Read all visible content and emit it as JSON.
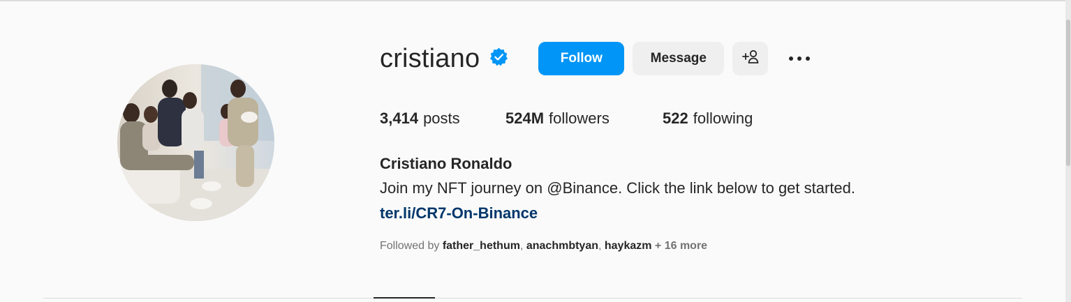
{
  "profile": {
    "username": "cristiano",
    "verified_icon": "verified-badge-icon",
    "full_name": "Cristiano Ronaldo",
    "bio": "Join my NFT journey on @Binance. Click the link below to get started.",
    "link": "ter.li/CR7-On-Binance",
    "avatar_alt": "profile-photo"
  },
  "actions": {
    "follow_label": "Follow",
    "message_label": "Message",
    "add_user_icon": "add-user-icon",
    "more_icon": "more-options-icon"
  },
  "stats": {
    "posts_count": "3,414",
    "posts_label": "posts",
    "followers_count": "524M",
    "followers_label": "followers",
    "following_count": "522",
    "following_label": "following"
  },
  "followed_by": {
    "prefix": "Followed by ",
    "users": [
      "father_hethum",
      "anachmbtyan",
      "haykazm"
    ],
    "sep": ", ",
    "more": " + 16 more"
  },
  "colors": {
    "accent": "#0095f6",
    "verified": "#0095f6",
    "link": "#00376b",
    "background": "#fafafa"
  }
}
